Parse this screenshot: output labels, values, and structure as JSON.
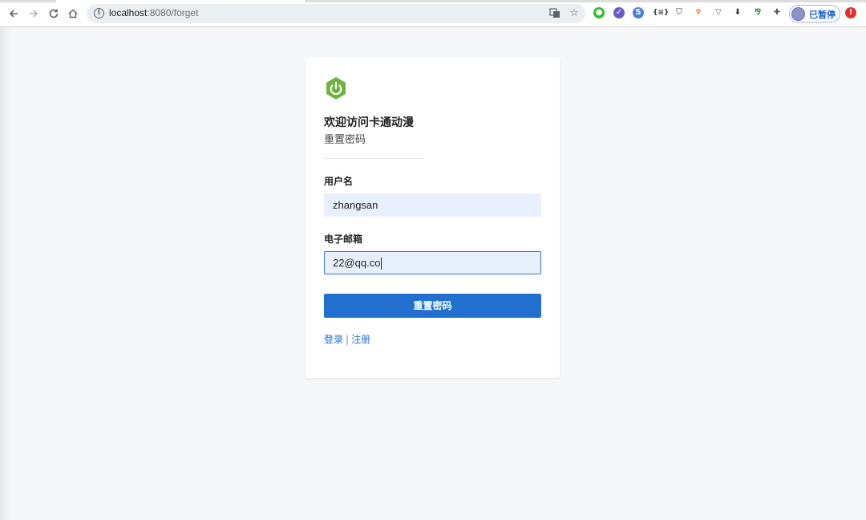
{
  "browser": {
    "url_host": "localhost",
    "url_rest": ":8080/forget",
    "profile_label": "已暂停"
  },
  "card": {
    "title": "欢迎访问卡通动漫",
    "subtitle": "重置密码",
    "username_label": "用户名",
    "username_value": "zhangsan",
    "email_label": "电子邮箱",
    "email_value": "22@qq.co",
    "submit_label": "重置密码",
    "login_link": "登录",
    "separator": "|",
    "register_link": "注册"
  },
  "colors": {
    "primary": "#2170cf",
    "logo_green": "#6db33f",
    "field_bg": "#e8f0fe"
  }
}
